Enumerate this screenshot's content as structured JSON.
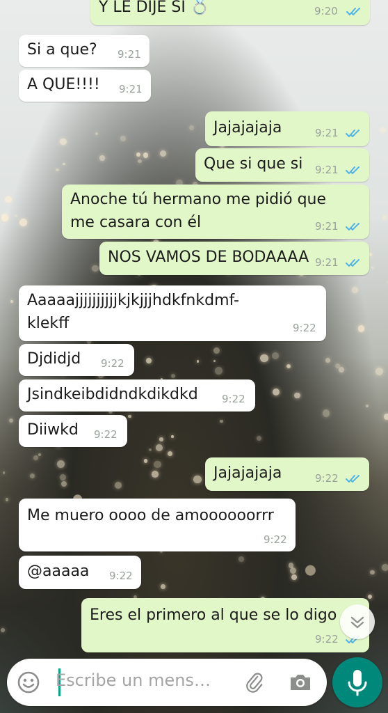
{
  "colors": {
    "incoming_bubble": "#ffffff",
    "outgoing_bubble": "#e2f7c8",
    "read_ticks": "#4fb3e8",
    "accent": "#00897b"
  },
  "messages": [
    {
      "text": "Y LE DIJE SI 💍",
      "time": "9:20",
      "direction": "out",
      "status": "read"
    },
    {
      "text": "Si a que?",
      "time": "9:21",
      "direction": "in"
    },
    {
      "text": "A QUE!!!!",
      "time": "9:21",
      "direction": "in"
    },
    {
      "text": "Jajajajaja",
      "time": "9:21",
      "direction": "out",
      "status": "read"
    },
    {
      "text": "Que si que si",
      "time": "9:21",
      "direction": "out",
      "status": "read"
    },
    {
      "text_line1": "Anoche tú hermano me pidió que",
      "text_line2": "me casara con él",
      "time": "9:21",
      "direction": "out",
      "status": "read"
    },
    {
      "text": "NOS VAMOS DE BODAAAA",
      "time": "9:21",
      "direction": "out",
      "status": "read"
    },
    {
      "text_line1": "Aaaaajjjjjjjjjjkjkjjjhdkfnkdmf-",
      "text_line2": "klekff",
      "time": "9:22",
      "direction": "in"
    },
    {
      "text": "Djdidjd",
      "time": "9:22",
      "direction": "in"
    },
    {
      "text": "Jsindkeibdidndkdikdkd",
      "time": "9:22",
      "direction": "in"
    },
    {
      "text": "Diiwkd",
      "time": "9:22",
      "direction": "in"
    },
    {
      "text": "Jajajajaja",
      "time": "9:22",
      "direction": "out",
      "status": "read"
    },
    {
      "text": "Me muero oooo de amoooooorrr",
      "time": "9:22",
      "direction": "in"
    },
    {
      "text": "@aaaaa",
      "time": "9:22",
      "direction": "in"
    },
    {
      "text": "Eres el primero al que se lo digo",
      "time": "9:22",
      "direction": "out",
      "status": "read"
    }
  ],
  "composer": {
    "placeholder": "Escribe un mens…",
    "emoji_icon": "emoji-icon",
    "attach_icon": "paperclip-icon",
    "camera_icon": "camera-icon",
    "mic_icon": "microphone-icon"
  },
  "scroll_down_icon": "double-chevron-down-icon"
}
